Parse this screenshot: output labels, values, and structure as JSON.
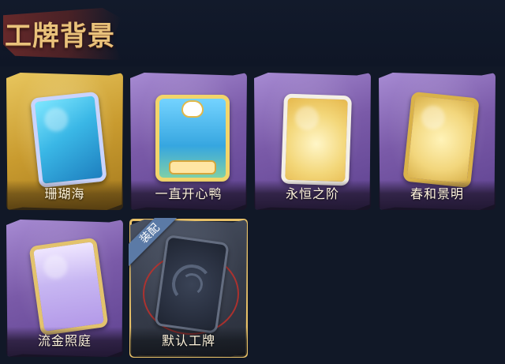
{
  "page": {
    "title": "工牌背景"
  },
  "cards": [
    {
      "label": "珊瑚海",
      "frame": "gold",
      "art": "coral-icon",
      "equipped": false
    },
    {
      "label": "一直开心鸭",
      "frame": "purple",
      "art": "duck-icon",
      "equipped": false
    },
    {
      "label": "永恒之阶",
      "frame": "purple",
      "art": "winged-frame-icon",
      "equipped": false
    },
    {
      "label": "春和景明",
      "frame": "purple",
      "art": "gold-frame-icon",
      "equipped": false
    },
    {
      "label": "流金照庭",
      "frame": "purple",
      "art": "gilded-arch-icon",
      "equipped": false
    },
    {
      "label": "默认工牌",
      "frame": "dark",
      "art": "swirl-icon",
      "equipped": true,
      "badge": "装配"
    }
  ],
  "colors": {
    "background": "#111827",
    "title": "#e9c27b",
    "purple_frame": "#7a5aa8",
    "gold_frame": "#c99b2f",
    "dark_frame": "#363c4a",
    "equipped_badge": "#5b7aa6",
    "selected_outline": "#e7c067"
  }
}
